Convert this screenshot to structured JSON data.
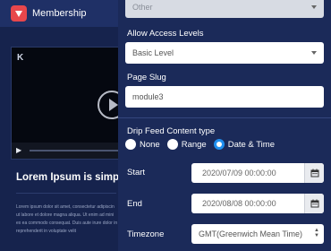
{
  "app": {
    "brand": "Membership"
  },
  "lesson": {
    "title": "Lorem Ipsum is simply du",
    "body_lines": [
      "Lorem ipsum dolor sit amet, consectetur adipiscin",
      "ut labore et dolore magna aliqua. Ut enim ad mini",
      "ex ea commodo consequat. Duis aute irure dolor in",
      "reprehenderit in voluptate velit"
    ]
  },
  "panel": {
    "top_select_value": "Other",
    "access": {
      "label": "Allow Access Levels",
      "value": "Basic Level"
    },
    "slug": {
      "label": "Page Slug",
      "value": "module3"
    },
    "drip": {
      "label": "Drip Feed Content type",
      "options": [
        "None",
        "Range",
        "Date & Time"
      ],
      "selected": "Date & Time"
    },
    "start": {
      "label": "Start",
      "value": "2020/07/09 00:00:00"
    },
    "end": {
      "label": "End",
      "value": "2020/08/08 00:00:00"
    },
    "timezone": {
      "label": "Timezone",
      "value": "GMT(Greenwich Mean Time)"
    }
  },
  "colors": {
    "panel_bg": "#1b2a59",
    "accent": "#1f8ff0",
    "logo": "#e8474c"
  }
}
